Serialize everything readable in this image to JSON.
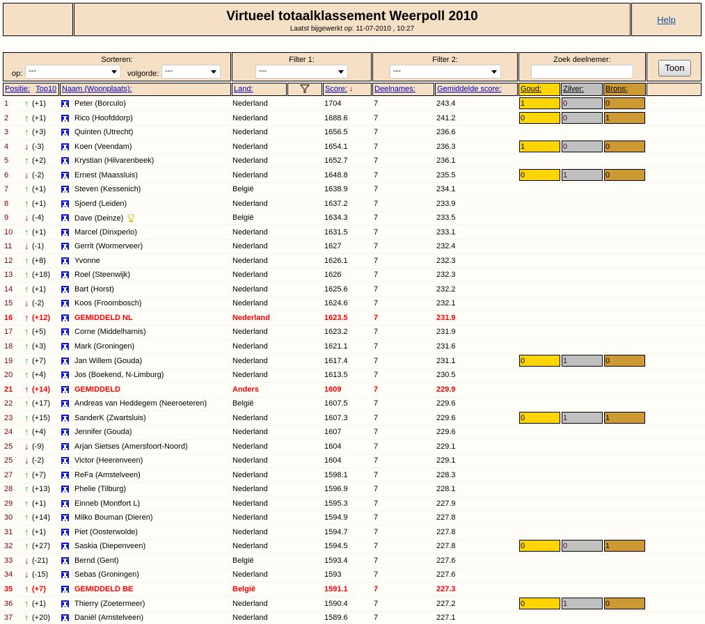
{
  "header": {
    "title": "Virtueel totaalklassement Weerpoll 2010",
    "updated": "Laatst bijgewerkt op: 11-07-2010 , 10:27",
    "help": "Help"
  },
  "controls": {
    "sort_label": "Sorteren:",
    "op_label": "op:",
    "op_value": "---",
    "volgorde_label": "volgorde:",
    "volgorde_value": "---",
    "filter1_label": "Filter 1:",
    "filter1_value": "---",
    "filter2_label": "Filter 2:",
    "filter2_value": "---",
    "search_label": "Zoek deelnemer:",
    "search_value": "",
    "toon": "Toon"
  },
  "columns": {
    "positie": "Positie:",
    "top10": "Top10",
    "naam": "Naam (Woonplaats):",
    "land": "Land:",
    "score": "Score:",
    "deelnames": "Deelnames:",
    "gemiddelde": "Gemiddelde score:",
    "goud": "Goud:",
    "zilver": "Zilver:",
    "brons": "Brons:"
  },
  "colors": {
    "up": "#00cc00",
    "down": "#e00000",
    "highlight": "#ff0000",
    "gold": "#ffd500",
    "silver": "#c0c0c0",
    "bronze": "#cc9933",
    "panel": "#f5e0c6"
  },
  "rows": [
    {
      "pos": "1",
      "dir": "up",
      "change": "(+1)",
      "name": "Peter (Borculo)",
      "land": "Nederland",
      "score": "1704",
      "deel": "7",
      "gem": "243.4",
      "medals": [
        "1",
        "0",
        "0"
      ]
    },
    {
      "pos": "2",
      "dir": "up",
      "change": "(+1)",
      "name": "Rico (Hoofddorp)",
      "land": "Nederland",
      "score": "1688.6",
      "deel": "7",
      "gem": "241.2",
      "medals": [
        "0",
        "0",
        "1"
      ]
    },
    {
      "pos": "3",
      "dir": "up",
      "change": "(+3)",
      "name": "Quinten (Utrecht)",
      "land": "Nederland",
      "score": "1656.5",
      "deel": "7",
      "gem": "236.6"
    },
    {
      "pos": "4",
      "dir": "down",
      "change": "(-3)",
      "name": "Koen (Veendam)",
      "land": "Nederland",
      "score": "1654.1",
      "deel": "7",
      "gem": "236.3",
      "medals": [
        "1",
        "0",
        "0"
      ]
    },
    {
      "pos": "5",
      "dir": "up",
      "change": "(+2)",
      "name": "Krystian (Hilvarenbeek)",
      "land": "Nederland",
      "score": "1652.7",
      "deel": "7",
      "gem": "236.1"
    },
    {
      "pos": "6",
      "dir": "down",
      "change": "(-2)",
      "name": "Ernest (Maassluis)",
      "land": "Nederland",
      "score": "1648.8",
      "deel": "7",
      "gem": "235.5",
      "medals": [
        "0",
        "1",
        "0"
      ]
    },
    {
      "pos": "7",
      "dir": "up",
      "change": "(+1)",
      "name": "Steven (Kessenich)",
      "land": "België",
      "score": "1638.9",
      "deel": "7",
      "gem": "234.1"
    },
    {
      "pos": "8",
      "dir": "up",
      "change": "(+1)",
      "name": "Sjoerd (Leiden)",
      "land": "Nederland",
      "score": "1637.2",
      "deel": "7",
      "gem": "233.9"
    },
    {
      "pos": "9",
      "dir": "down",
      "change": "(-4)",
      "name": "Dave (Deinze)",
      "land": "België",
      "score": "1634.3",
      "deel": "7",
      "gem": "233.5",
      "trophy": true
    },
    {
      "pos": "10",
      "dir": "up",
      "change": "(+1)",
      "name": "Marcel (Dinxperlo)",
      "land": "Nederland",
      "score": "1631.5",
      "deel": "7",
      "gem": "233.1"
    },
    {
      "pos": "11",
      "dir": "down",
      "change": "(-1)",
      "name": "Gerrit (Wormerveer)",
      "land": "Nederland",
      "score": "1627",
      "deel": "7",
      "gem": "232.4"
    },
    {
      "pos": "12",
      "dir": "up",
      "change": "(+8)",
      "name": "Yvonne",
      "land": "Nederland",
      "score": "1626.1",
      "deel": "7",
      "gem": "232.3"
    },
    {
      "pos": "13",
      "dir": "up",
      "change": "(+18)",
      "name": "Roel (Steenwijk)",
      "land": "Nederland",
      "score": "1626",
      "deel": "7",
      "gem": "232.3"
    },
    {
      "pos": "14",
      "dir": "up",
      "change": "(+1)",
      "name": "Bart (Horst)",
      "land": "Nederland",
      "score": "1625.6",
      "deel": "7",
      "gem": "232.2"
    },
    {
      "pos": "15",
      "dir": "down",
      "change": "(-2)",
      "name": "Koos (Froombosch)",
      "land": "Nederland",
      "score": "1624.6",
      "deel": "7",
      "gem": "232.1"
    },
    {
      "pos": "16",
      "dir": "up",
      "change": "(+12)",
      "name": "GEMIDDELD NL",
      "land": "Nederland",
      "score": "1623.5",
      "deel": "7",
      "gem": "231.9",
      "highlight": true
    },
    {
      "pos": "17",
      "dir": "up",
      "change": "(+5)",
      "name": "Corne (Middelharnis)",
      "land": "Nederland",
      "score": "1623.2",
      "deel": "7",
      "gem": "231.9"
    },
    {
      "pos": "18",
      "dir": "up",
      "change": "(+3)",
      "name": "Mark (Groningen)",
      "land": "Nederland",
      "score": "1621.1",
      "deel": "7",
      "gem": "231.6"
    },
    {
      "pos": "19",
      "dir": "up",
      "change": "(+7)",
      "name": "Jan Willem (Gouda)",
      "land": "Nederland",
      "score": "1617.4",
      "deel": "7",
      "gem": "231.1",
      "medals": [
        "0",
        "1",
        "0"
      ]
    },
    {
      "pos": "20",
      "dir": "up",
      "change": "(+4)",
      "name": "Jos (Boekend, N-Limburg)",
      "land": "Nederland",
      "score": "1613.5",
      "deel": "7",
      "gem": "230.5"
    },
    {
      "pos": "21",
      "dir": "up",
      "change": "(+14)",
      "name": "GEMIDDELD",
      "land": "Anders",
      "score": "1609",
      "deel": "7",
      "gem": "229.9",
      "highlight": true
    },
    {
      "pos": "22",
      "dir": "up",
      "change": "(+17)",
      "name": "Andreas van Heddegem (Neeroeteren)",
      "land": "België",
      "score": "1607.5",
      "deel": "7",
      "gem": "229.6"
    },
    {
      "pos": "23",
      "dir": "up",
      "change": "(+15)",
      "name": "SanderK (Zwartsluis)",
      "land": "Nederland",
      "score": "1607.3",
      "deel": "7",
      "gem": "229.6",
      "medals": [
        "0",
        "1",
        "1"
      ]
    },
    {
      "pos": "24",
      "dir": "up",
      "change": "(+4)",
      "name": "Jennifer (Gouda)",
      "land": "Nederland",
      "score": "1607",
      "deel": "7",
      "gem": "229.6"
    },
    {
      "pos": "25",
      "dir": "down",
      "change": "(-9)",
      "name": "Arjan Sietses (Amersfoort-Noord)",
      "land": "Nederland",
      "score": "1604",
      "deel": "7",
      "gem": "229.1"
    },
    {
      "pos": "25",
      "dir": "down",
      "change": "(-2)",
      "name": "Victor (Heerenveen)",
      "land": "Nederland",
      "score": "1604",
      "deel": "7",
      "gem": "229.1"
    },
    {
      "pos": "27",
      "dir": "up",
      "change": "(+7)",
      "name": "ReFa (Amstelveen)",
      "land": "Nederland",
      "score": "1598.1",
      "deel": "7",
      "gem": "228.3"
    },
    {
      "pos": "28",
      "dir": "up",
      "change": "(+13)",
      "name": "Phelie (Tilburg)",
      "land": "Nederland",
      "score": "1596.9",
      "deel": "7",
      "gem": "228.1"
    },
    {
      "pos": "29",
      "dir": "up",
      "change": "(+1)",
      "name": "Einneb (Montfort L)",
      "land": "Nederland",
      "score": "1595.3",
      "deel": "7",
      "gem": "227.9"
    },
    {
      "pos": "30",
      "dir": "up",
      "change": "(+14)",
      "name": "Milko Bouman (Dieren)",
      "land": "Nederland",
      "score": "1594.9",
      "deel": "7",
      "gem": "227.8"
    },
    {
      "pos": "31",
      "dir": "up",
      "change": "(+1)",
      "name": "Piet (Oosterwolde)",
      "land": "Nederland",
      "score": "1594.7",
      "deel": "7",
      "gem": "227.8"
    },
    {
      "pos": "32",
      "dir": "up",
      "change": "(+27)",
      "name": "Saskia (Diepenveen)",
      "land": "Nederland",
      "score": "1594.5",
      "deel": "7",
      "gem": "227.8",
      "medals": [
        "0",
        "0",
        "1"
      ]
    },
    {
      "pos": "33",
      "dir": "down",
      "change": "(-21)",
      "name": "Bernd (Gent)",
      "land": "België",
      "score": "1593.4",
      "deel": "7",
      "gem": "227.6"
    },
    {
      "pos": "34",
      "dir": "down",
      "change": "(-15)",
      "name": "Sebas (Groningen)",
      "land": "Nederland",
      "score": "1593",
      "deel": "7",
      "gem": "227.6"
    },
    {
      "pos": "35",
      "dir": "up",
      "change": "(+7)",
      "name": "GEMIDDELD BE",
      "land": "België",
      "score": "1591.1",
      "deel": "7",
      "gem": "227.3",
      "highlight": true
    },
    {
      "pos": "36",
      "dir": "up",
      "change": "(+1)",
      "name": "Thierry (Zoetermeer)",
      "land": "Nederland",
      "score": "1590.4",
      "deel": "7",
      "gem": "227.2",
      "medals": [
        "0",
        "1",
        "0"
      ]
    },
    {
      "pos": "37",
      "dir": "up",
      "change": "(+20)",
      "name": "Daniël (Amstelveen)",
      "land": "Nederland",
      "score": "1589.6",
      "deel": "7",
      "gem": "227.1"
    }
  ]
}
